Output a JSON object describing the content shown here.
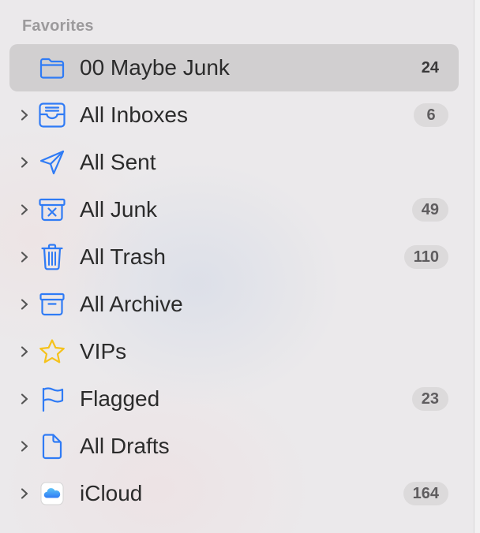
{
  "sidebar": {
    "section_title": "Favorites",
    "items": [
      {
        "label": "00 Maybe Junk",
        "count": "24",
        "icon": "folder-icon"
      },
      {
        "label": "All Inboxes",
        "count": "6",
        "icon": "inbox-tray-icon"
      },
      {
        "label": "All Sent",
        "count": "",
        "icon": "paper-plane-icon"
      },
      {
        "label": "All Junk",
        "count": "49",
        "icon": "junk-bin-icon"
      },
      {
        "label": "All Trash",
        "count": "110",
        "icon": "trash-icon"
      },
      {
        "label": "All Archive",
        "count": "",
        "icon": "archive-box-icon"
      },
      {
        "label": "VIPs",
        "count": "",
        "icon": "star-icon"
      },
      {
        "label": "Flagged",
        "count": "23",
        "icon": "flag-icon"
      },
      {
        "label": "All Drafts",
        "count": "",
        "icon": "document-icon"
      },
      {
        "label": "iCloud",
        "count": "164",
        "icon": "icloud-icon"
      }
    ]
  },
  "colors": {
    "accent_blue": "#2f7bf5",
    "vip_star": "#f5c21b",
    "selected_row": "#d1cfd0",
    "badge_bg": "#dcdadb"
  }
}
